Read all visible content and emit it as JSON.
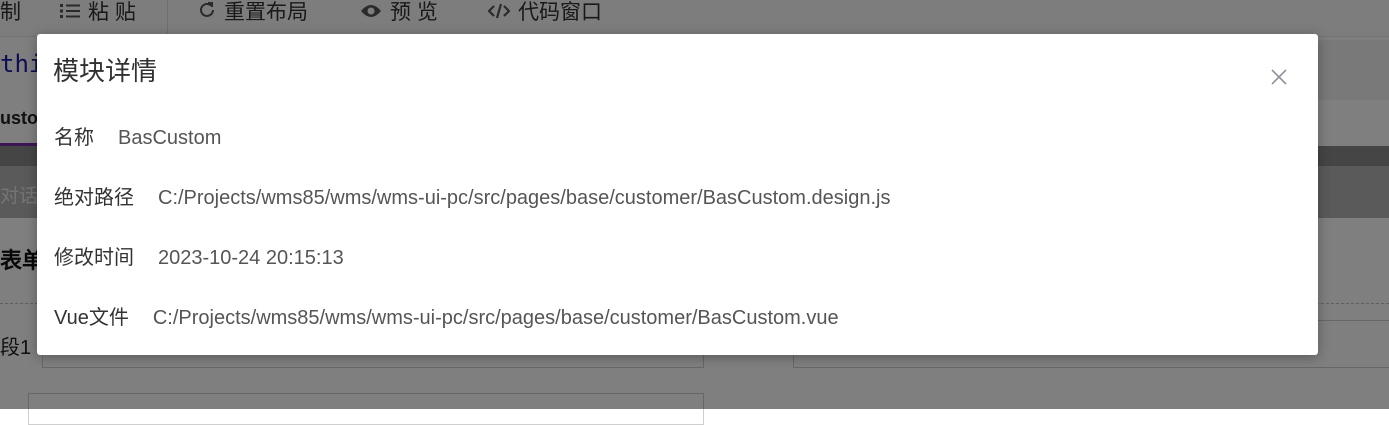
{
  "toolbar": {
    "copy_label": "制",
    "paste_label": "粘 贴",
    "reset_layout_label": "重置布局",
    "preview_label": "预 览",
    "code_window_label": "代码窗口"
  },
  "editor": {
    "code_snippet": "thi"
  },
  "tabs": {
    "active_label": "usto"
  },
  "dialog_bar": {
    "text": "对话"
  },
  "form": {
    "title": "表单",
    "field_label": "段1"
  },
  "modal": {
    "title": "模块详情",
    "rows": [
      {
        "label": "名称",
        "value": "BasCustom"
      },
      {
        "label": "绝对路径",
        "value": "C:/Projects/wms85/wms/wms-ui-pc/src/pages/base/customer/BasCustom.design.js"
      },
      {
        "label": "修改时间",
        "value": "2023-10-24 20:15:13"
      },
      {
        "label": "Vue文件",
        "value": "C:/Projects/wms85/wms/wms-ui-pc/src/pages/base/customer/BasCustom.vue"
      }
    ]
  },
  "icons": {
    "paste": "list-icon",
    "reset": "refresh-icon",
    "preview": "eye-icon",
    "code": "code-icon",
    "close": "close-icon"
  },
  "colors": {
    "overlay": "rgba(0,0,0,0.5)",
    "accent_tab": "#7b2aa8",
    "code_text": "#1a1aa6"
  }
}
